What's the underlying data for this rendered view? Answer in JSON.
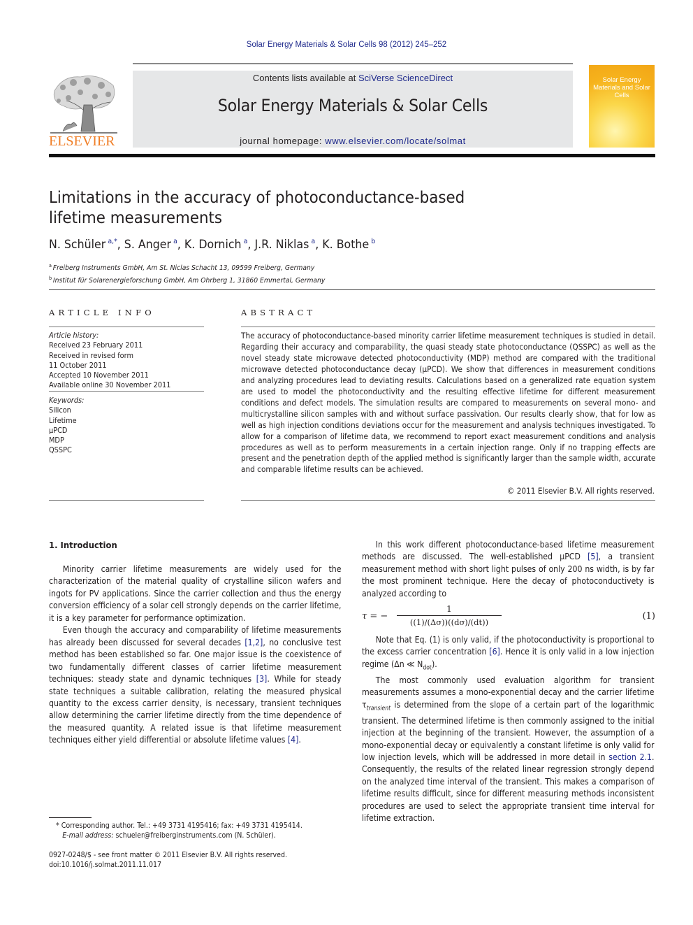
{
  "journal_citation": "Solar Energy Materials & Solar Cells 98 (2012) 245–252",
  "masthead": {
    "contents_prefix": "Contents lists available at ",
    "contents_link": "SciVerse ScienceDirect",
    "journal_title": "Solar Energy Materials & Solar Cells",
    "homepage_prefix": "journal homepage: ",
    "homepage_link": "www.elsevier.com/locate/solmat",
    "publisher_logo_text": "ELSEVIER",
    "cover_title": "Solar Energy Materials and Solar Cells",
    "colors": {
      "publisher_orange": "#f07e26",
      "link_blue": "#1f2a8c",
      "masthead_gray": "#e6e7e8"
    }
  },
  "article": {
    "title": "Limitations in the accuracy of photoconductance-based lifetime measurements",
    "authors": [
      {
        "name": "N. Schüler",
        "sup": "a,*"
      },
      {
        "name": "S. Anger",
        "sup": "a"
      },
      {
        "name": "K. Dornich",
        "sup": "a"
      },
      {
        "name": "J.R. Niklas",
        "sup": "a"
      },
      {
        "name": "K. Bothe",
        "sup": "b"
      }
    ],
    "affiliations": [
      {
        "mark": "a",
        "text": "Freiberg Instruments GmbH, Am St. Niclas Schacht 13, 09599 Freiberg, Germany"
      },
      {
        "mark": "b",
        "text": "Institut für Solarenergieforschung GmbH, Am Ohrberg 1, 31860 Emmertal, Germany"
      }
    ]
  },
  "article_info": {
    "heading": "ARTICLE INFO",
    "history_label": "Article history:",
    "history": [
      "Received 23 February 2011",
      "Received in revised form",
      "11 October 2011",
      "Accepted 10 November 2011",
      "Available online 30 November 2011"
    ],
    "keywords_label": "Keywords:",
    "keywords": [
      "Silicon",
      "Lifetime",
      "µPCD",
      "MDP",
      "QSSPC"
    ]
  },
  "abstract": {
    "heading": "ABSTRACT",
    "text": "The accuracy of photoconductance-based minority carrier lifetime measurement techniques is studied in detail. Regarding their accuracy and comparability, the quasi steady state photoconductance (QSSPC) as well as the novel steady state microwave detected photoconductivity (MDP) method are compared with the traditional microwave detected photoconductance decay (µPCD). We show that differences in measurement conditions and analyzing procedures lead to deviating results. Calculations based on a generalized rate equation system are used to model the photoconductivity and the resulting effective lifetime for different measurement conditions and defect models. The simulation results are compared to measurements on several mono- and multicrystalline silicon samples with and without surface passivation. Our results clearly show, that for low as well as high injection conditions deviations occur for the measurement and analysis techniques investigated. To allow for a comparison of lifetime data, we recommend to report exact measurement conditions and analysis procedures as well as to perform measurements in a certain injection range. Only if no trapping effects are present and the penetration depth of the applied method is significantly larger than the sample width, accurate and comparable lifetime results can be achieved.",
    "copyright": "© 2011 Elsevier B.V. All rights reserved."
  },
  "body": {
    "section_heading": "1.  Introduction",
    "left_paragraphs": [
      [
        {
          "t": "Minority carrier lifetime measurements are widely used for the characterization of the material quality of crystalline silicon wafers and ingots for PV applications. Since the carrier collection and thus the energy conversion efficiency of a solar cell strongly depends on the carrier lifetime, it is a key parameter for performance optimization."
        }
      ],
      [
        {
          "t": "Even though the accuracy and comparability of lifetime measurements has already been discussed for several decades "
        },
        {
          "ref": "[1,2]"
        },
        {
          "t": ", no conclusive test method has been established so far. One major issue is the coexistence of two fundamentally different classes of carrier lifetime measurement techniques: steady state and dynamic techniques "
        },
        {
          "ref": "[3]"
        },
        {
          "t": ". While for steady state techniques a suitable calibration, relating the measured physical quantity to the excess carrier density, is necessary, transient techniques allow determining the carrier lifetime directly from the time dependence of the measured quantity. A related issue is that lifetime measurement techniques either yield differential or absolute lifetime values "
        },
        {
          "ref": "[4]"
        },
        {
          "t": "."
        }
      ]
    ],
    "right_paragraph_1": [
      {
        "t": "In this work different photoconductance-based lifetime measurement methods are discussed. The well-established µPCD "
      },
      {
        "ref": "[5]"
      },
      {
        "t": ", a transient measurement method with short light pulses of only 200 ns width, is by far the most prominent technique. Here the decay of photoconductivety is analyzed according to"
      }
    ],
    "equation": {
      "lhs": "τ = −",
      "numerator": "1",
      "denominator": "((1)/(Δσ))((dσ)/(dt))",
      "number": "(1)"
    },
    "right_paragraph_2": [
      {
        "t": "Note that Eq. (1) is only valid, if the photoconductivity is proportional to the excess carrier concentration "
      },
      {
        "ref": "[6]"
      },
      {
        "t": ". Hence it is only valid in a low injection regime (Δn ≪ N"
      },
      {
        "sub": "dot"
      },
      {
        "t": ")."
      }
    ],
    "right_paragraph_3": [
      {
        "t": "The most commonly used evaluation algorithm for transient measurements assumes a mono-exponential decay and the carrier lifetime τ"
      },
      {
        "sub_i": "transient"
      },
      {
        "t": " is determined from the slope of a certain part of the logarithmic transient. The determined lifetime is then commonly assigned to the initial injection at the beginning of the transient. However, the assumption of a mono-exponential decay or equivalently a constant lifetime is only valid for low injection levels, which will be addressed in more detail in "
      },
      {
        "ref": "section 2.1"
      },
      {
        "t": ". Consequently, the results of the related linear regression strongly depend on the analyzed time interval of the transient. This makes a comparison of lifetime results difficult, since for different measuring methods inconsistent procedures are used to select the appropriate transient time interval for lifetime extraction."
      }
    ]
  },
  "footnotes": {
    "corresponding": "* Corresponding author. Tel.: +49 3731 4195416; fax: +49 3731 4195414.",
    "email_label": "E-mail address:",
    "email": " schueler@freiberginstruments.com (N. Schüler).",
    "issn_line": "0927-0248/$ - see front matter © 2011 Elsevier B.V. All rights reserved.",
    "doi": "doi:10.1016/j.solmat.2011.11.017"
  }
}
